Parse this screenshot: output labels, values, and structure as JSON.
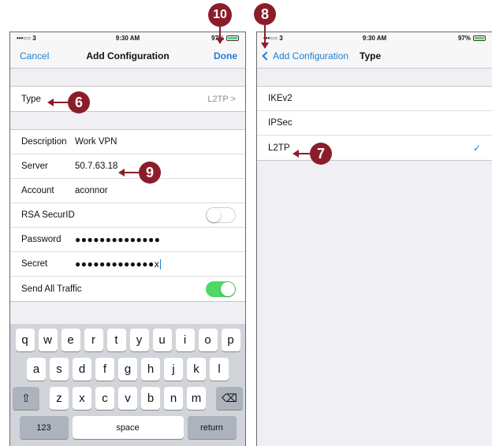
{
  "left": {
    "status": {
      "carrier": "•••○○ 3",
      "time": "9:30 AM",
      "battery": "97%",
      "battery_level": 0.97
    },
    "nav": {
      "cancel": "Cancel",
      "title": "Add Configuration",
      "done": "Done"
    },
    "type_row": {
      "label": "Type",
      "value": "L2TP",
      "chevron": ">"
    },
    "fields": {
      "description": {
        "label": "Description",
        "value": "Work VPN"
      },
      "server": {
        "label": "Server",
        "value": "50.7.63.18"
      },
      "account": {
        "label": "Account",
        "value": "aconnor"
      },
      "rsa": {
        "label": "RSA SecurID",
        "on": false
      },
      "password": {
        "label": "Password",
        "value": "●●●●●●●●●●●●●●"
      },
      "secret": {
        "label": "Secret",
        "value": "●●●●●●●●●●●●●x"
      },
      "send_all": {
        "label": "Send All Traffic",
        "on": true
      }
    },
    "keyboard": {
      "row1": [
        "q",
        "w",
        "e",
        "r",
        "t",
        "y",
        "u",
        "i",
        "o",
        "p"
      ],
      "row2": [
        "a",
        "s",
        "d",
        "f",
        "g",
        "h",
        "j",
        "k",
        "l"
      ],
      "row3": [
        "z",
        "x",
        "c",
        "v",
        "b",
        "n",
        "m"
      ],
      "shift": "⇧",
      "delete": "⌫",
      "numbers": "123",
      "space": "space",
      "return": "return"
    }
  },
  "right": {
    "status": {
      "carrier": "•••○○ 3",
      "time": "9:30 AM",
      "battery": "97%",
      "battery_level": 0.97
    },
    "nav": {
      "back": "Add Configuration",
      "title": "Type"
    },
    "options": [
      {
        "label": "IKEv2",
        "selected": false
      },
      {
        "label": "IPSec",
        "selected": false
      },
      {
        "label": "L2TP",
        "selected": true
      }
    ],
    "checkmark": "✓"
  },
  "callouts": {
    "c6": "6",
    "c7": "7",
    "c8": "8",
    "c9": "9",
    "c10": "10"
  },
  "colors": {
    "accent": "#1a7fd4",
    "callout": "#8b1d2a",
    "toggle_on": "#4cd964"
  }
}
